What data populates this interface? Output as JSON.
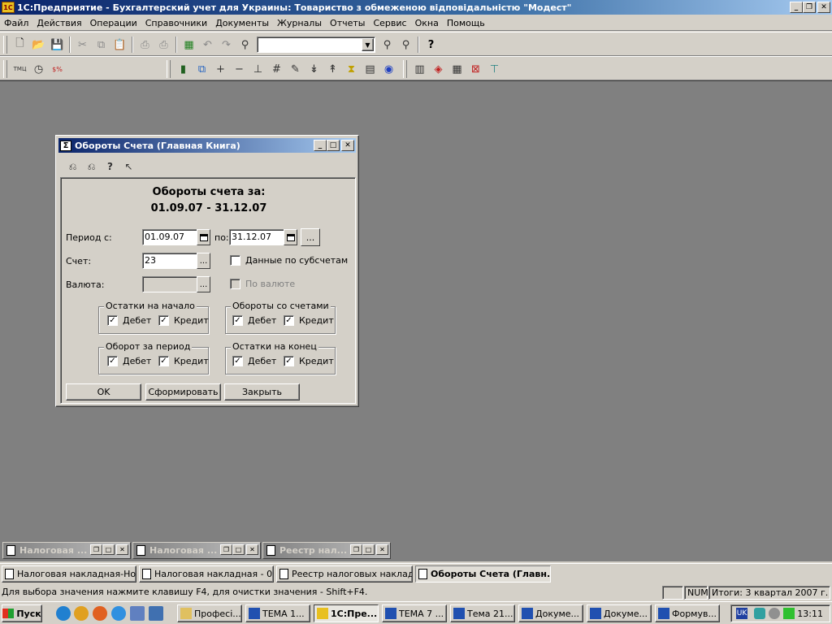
{
  "app": {
    "title": "1С:Предприятие - Бухгалтерский учет для Украины: Товариство з обмеженою відповідальністю \"Модест\"",
    "icon": "1c-app-icon"
  },
  "menu": [
    "Файл",
    "Действия",
    "Операции",
    "Справочники",
    "Документы",
    "Журналы",
    "Отчеты",
    "Сервис",
    "Окна",
    "Помощь"
  ],
  "toolbar2": {
    "labels": [
      "ТМЦ",
      "$%"
    ]
  },
  "dialog": {
    "title": "Обороты Счета (Главная Книга)",
    "heading1": "Обороты счета за:",
    "heading2": "01.09.07 - 31.12.07",
    "period_from_label": "Период с:",
    "period_from_value": "01.09.07",
    "period_to_label": "по:",
    "period_to_value": "31.12.07",
    "ellipsis": "...",
    "account_label": "Счет:",
    "account_value": "23",
    "subaccounts_label": "Данные по субсчетам",
    "currency_label": "Валюта:",
    "currency_value": "",
    "by_currency_label": "По валюте",
    "groups": [
      {
        "caption": "Остатки на начало",
        "debit": "Дебет",
        "credit": "Кредит"
      },
      {
        "caption": "Обороты со счетами",
        "debit": "Дебет",
        "credit": "Кредит"
      },
      {
        "caption": "Оборот за период",
        "debit": "Дебет",
        "credit": "Кредит"
      },
      {
        "caption": "Остатки на конец",
        "debit": "Дебет",
        "credit": "Кредит"
      }
    ],
    "ok_label": "OK",
    "form_label": "Сформировать",
    "close_label": "Закрыть"
  },
  "minimized": [
    "Налоговая ...",
    "Налоговая ...",
    "Реестр нал..."
  ],
  "windowlist": [
    "Налоговая накладная-Но...",
    "Налоговая накладная - 0...",
    "Реестр налоговых наклад...",
    "Обороты Счета (Главн..."
  ],
  "status": {
    "hint": "Для выбора значения нажмите клавишу F4, для очистки значения - Shift+F4.",
    "num": "NUM",
    "totals": "Итоги: 3 квартал 2007 г."
  },
  "taskbar": {
    "start": "Пуск",
    "tasks": [
      "Професі...",
      "ТЕМА 1...",
      "1С:Пре...",
      "ТЕМА 7 ...",
      "Тема 21...",
      "Докуме...",
      "Докуме...",
      "Формув..."
    ],
    "lang": "UK",
    "clock": "13:11"
  }
}
